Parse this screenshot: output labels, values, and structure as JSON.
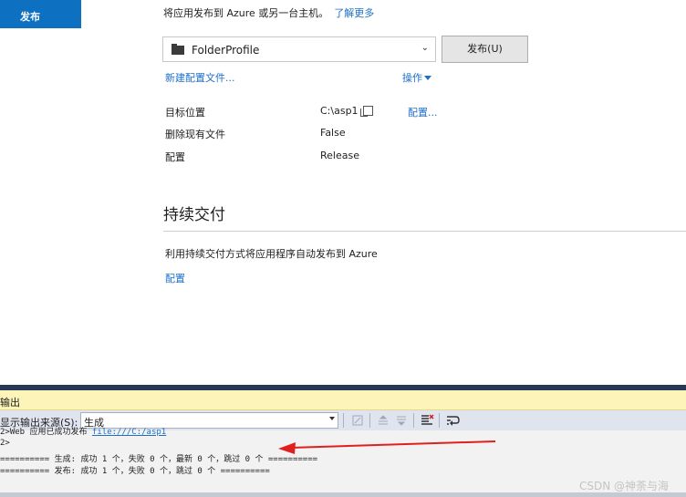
{
  "nav": {
    "publish_label": "发布"
  },
  "intro": {
    "text": "将应用发布到 Azure 或另一台主机。",
    "learn_more": "了解更多"
  },
  "profile": {
    "selected": "FolderProfile",
    "publish_button": "发布(U)",
    "new_profile_link": "新建配置文件...",
    "actions_link": "操作"
  },
  "properties": [
    {
      "label": "目标位置",
      "value": "C:\\asp1"
    },
    {
      "label": "删除现有文件",
      "value": "False"
    },
    {
      "label": "配置",
      "value": "Release"
    }
  ],
  "configure_link": "配置...",
  "continuous_delivery": {
    "title": "持续交付",
    "description": "利用持续交付方式将应用程序自动发布到 Azure",
    "config_link": "配置"
  },
  "output": {
    "title": "输出",
    "source_label": "显示输出来源(S):",
    "source_value": "生成",
    "lines": [
      {
        "text": "2>Web 应用已成功发布 ",
        "link": "file:///C:/asp1"
      },
      {
        "text": "2>"
      },
      {
        "text": "========== 生成: 成功 1 个，失败 0 个，最新 0 个，跳过 0 个 =========="
      },
      {
        "text": "========== 发布: 成功 1 个，失败 0 个，跳过 0 个 =========="
      }
    ]
  },
  "watermark": "CSDN @神荼与海",
  "colors": {
    "accent": "#0e70c0",
    "link": "#1e6fc8",
    "output_header": "#fcf4b8",
    "arrow": "#e02020"
  }
}
